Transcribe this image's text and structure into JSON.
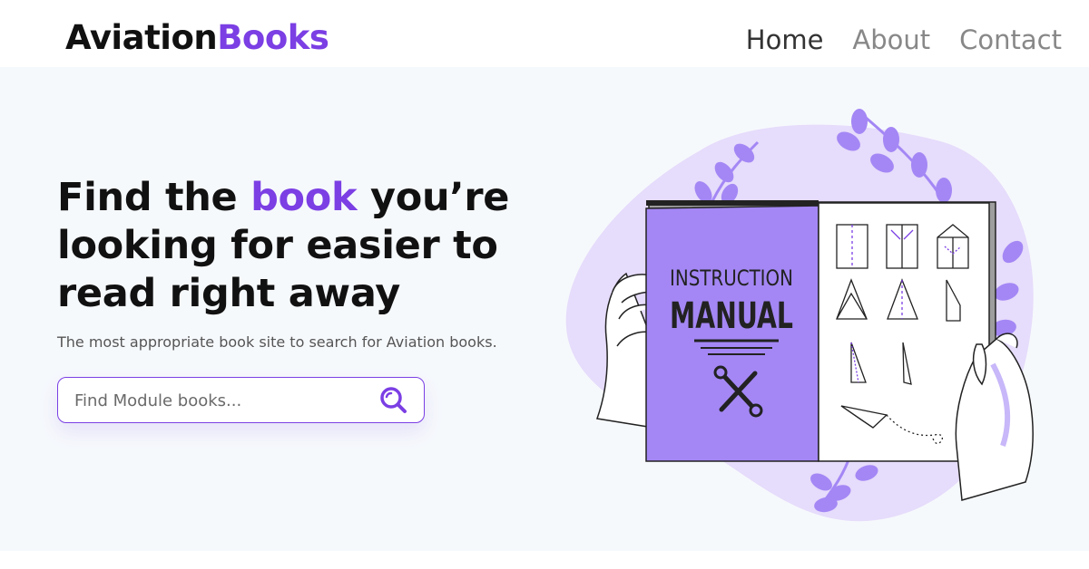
{
  "header": {
    "logo": {
      "part1": "Aviation",
      "part2": "Books"
    },
    "nav": [
      {
        "label": "Home",
        "active": true
      },
      {
        "label": "About",
        "active": false
      },
      {
        "label": "Contact",
        "active": false
      }
    ]
  },
  "hero": {
    "headline": {
      "before": "Find the ",
      "highlight": "book",
      "after": " you’re looking for easier to read right away"
    },
    "subtitle": "The most appropriate book site to search for Aviation books.",
    "search": {
      "placeholder": "Find Module books...",
      "value": "",
      "icon": "search-icon"
    }
  },
  "illustration": {
    "cover_line1": "INSTRUCTION",
    "cover_line2": "MANUAL",
    "icons": [
      "wrench-screwdriver-icon",
      "paper-plane-icon",
      "leaf-icon",
      "hand-icon"
    ]
  },
  "colors": {
    "accent": "#7b3fe4",
    "accent_light": "#e6dcfb",
    "accent_mid": "#a487f5",
    "hero_bg": "#f6f9fc",
    "text_dark": "#111111"
  }
}
